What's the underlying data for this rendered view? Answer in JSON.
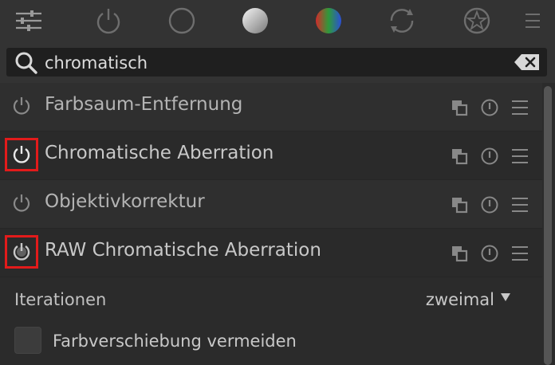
{
  "toolbar": {
    "items": [
      "sliders-icon",
      "power-icon",
      "circle-outline-icon",
      "gradient-circle-icon",
      "color-circle-icon",
      "refresh-icon",
      "star-badge-icon",
      "hamburger-menu-icon"
    ]
  },
  "search": {
    "value": "chromatisch"
  },
  "modules": [
    {
      "label": "Farbsaum-Entfernung",
      "highlighted": false
    },
    {
      "label": "Chromatische Aberration",
      "highlighted": true
    },
    {
      "label": "Objektivkorrektur",
      "highlighted": false
    },
    {
      "label": "RAW Chromatische Aberration",
      "highlighted": true
    }
  ],
  "params": {
    "iterations_label": "Iterationen",
    "iterations_value": "zweimal",
    "checkbox_label": "Farbverschiebung vermeiden"
  },
  "colors": {
    "highlight": "#e21b1b",
    "background": "#333333",
    "list_background": "#2b2b2b"
  }
}
